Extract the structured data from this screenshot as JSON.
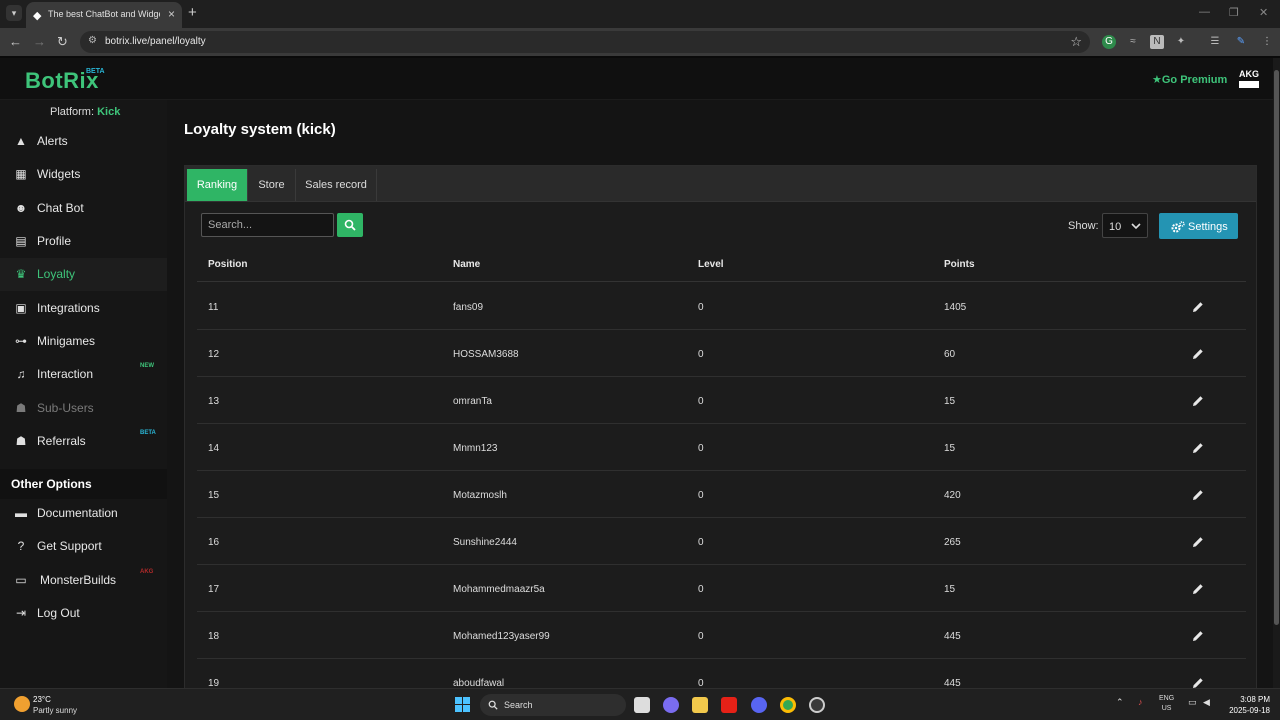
{
  "browser": {
    "tab_title": "The best ChatBot and Widgets",
    "url": "botrix.live/panel/loyalty"
  },
  "header": {
    "logo": "BotRix",
    "logo_badge": "BETA",
    "premium_label": "Go Premium",
    "user_logo_text": "AKG"
  },
  "sidebar": {
    "platform_label": "Platform:",
    "platform_value": "Kick",
    "items": [
      {
        "label": "Alerts",
        "icon": "warning-icon"
      },
      {
        "label": "Widgets",
        "icon": "grid-icon"
      },
      {
        "label": "Chat Bot",
        "icon": "robot-icon"
      },
      {
        "label": "Profile",
        "icon": "id-card-icon"
      },
      {
        "label": "Loyalty",
        "icon": "trophy-icon",
        "active": true
      },
      {
        "label": "Integrations",
        "icon": "plug-icon"
      },
      {
        "label": "Minigames",
        "icon": "gamepad-icon"
      },
      {
        "label": "Interaction",
        "icon": "music-icon",
        "badge": "NEW"
      },
      {
        "label": "Sub-Users",
        "icon": "users-icon",
        "disabled": true
      },
      {
        "label": "Referrals",
        "icon": "user-group-icon",
        "badge": "BETA"
      }
    ],
    "other_title": "Other Options",
    "other_items": [
      {
        "label": "Documentation",
        "icon": "scroll-icon"
      },
      {
        "label": "Get Support",
        "icon": "question-icon"
      },
      {
        "label": "MonsterBuilds",
        "icon": "laptop-icon",
        "badge": "AKG"
      },
      {
        "label": "Log Out",
        "icon": "logout-icon"
      }
    ]
  },
  "main": {
    "title": "Loyalty system (kick)",
    "tabs": [
      "Ranking",
      "Store",
      "Sales record"
    ],
    "search_placeholder": "Search...",
    "show_label": "Show:",
    "show_value": "10",
    "settings_label": "Settings",
    "columns": [
      "Position",
      "Name",
      "Level",
      "Points"
    ],
    "rows": [
      {
        "position": "11",
        "name": "fans09",
        "level": "0",
        "points": "1405"
      },
      {
        "position": "12",
        "name": "HOSSAM3688",
        "level": "0",
        "points": "60"
      },
      {
        "position": "13",
        "name": "omranTa",
        "level": "0",
        "points": "15"
      },
      {
        "position": "14",
        "name": "Mnmn123",
        "level": "0",
        "points": "15"
      },
      {
        "position": "15",
        "name": "Motazmoslh",
        "level": "0",
        "points": "420"
      },
      {
        "position": "16",
        "name": "Sunshine2444",
        "level": "0",
        "points": "265"
      },
      {
        "position": "17",
        "name": "Mohammedmaazr5a",
        "level": "0",
        "points": "15"
      },
      {
        "position": "18",
        "name": "Mohamed123yaser99",
        "level": "0",
        "points": "445"
      },
      {
        "position": "19",
        "name": "aboudfawal",
        "level": "0",
        "points": "445"
      }
    ]
  },
  "taskbar": {
    "temperature": "23°C",
    "weather": "Partly sunny",
    "search_label": "Search",
    "lang": "ENG",
    "region": "US",
    "time": "3:08 PM",
    "date": "2025-09-18"
  },
  "colors": {
    "accent_green": "#2fb565",
    "accent_blue": "#2494b3",
    "background": "#141414"
  }
}
